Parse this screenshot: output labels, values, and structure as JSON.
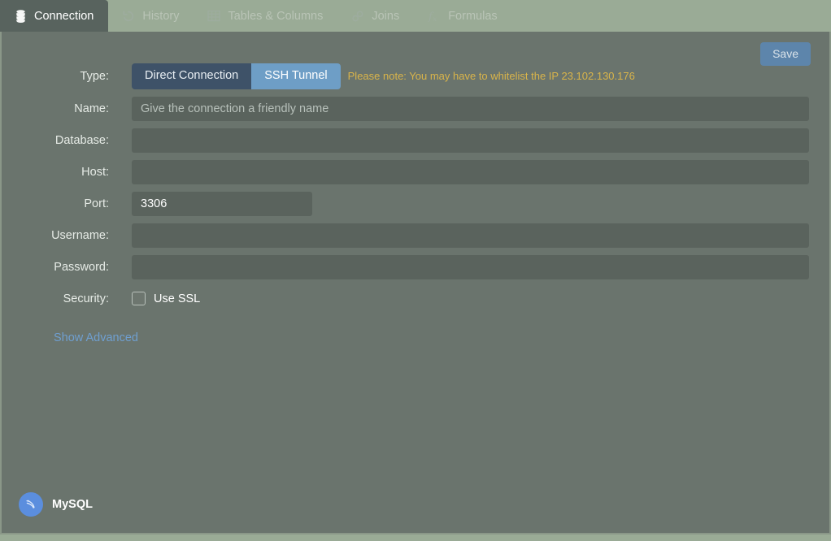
{
  "tabs": [
    {
      "label": "Connection",
      "icon": "database-icon",
      "active": true
    },
    {
      "label": "History",
      "icon": "history-icon",
      "active": false
    },
    {
      "label": "Tables & Columns",
      "icon": "table-grid-icon",
      "active": false
    },
    {
      "label": "Joins",
      "icon": "link-icon",
      "active": false
    },
    {
      "label": "Formulas",
      "icon": "function-icon",
      "active": false
    }
  ],
  "toolbar": {
    "save_label": "Save"
  },
  "form": {
    "type": {
      "label": "Type:",
      "options": [
        "Direct Connection",
        "SSH Tunnel"
      ],
      "selected": "SSH Tunnel",
      "note": "Please note: You may have to whitelist the IP 23.102.130.176"
    },
    "name": {
      "label": "Name:",
      "value": "",
      "placeholder": "Give the connection a friendly name"
    },
    "database": {
      "label": "Database:",
      "value": "",
      "placeholder": ""
    },
    "host": {
      "label": "Host:",
      "value": "",
      "placeholder": ""
    },
    "port": {
      "label": "Port:",
      "value": "3306",
      "placeholder": ""
    },
    "username": {
      "label": "Username:",
      "value": "",
      "placeholder": ""
    },
    "password": {
      "label": "Password:",
      "value": "",
      "placeholder": ""
    },
    "security": {
      "label": "Security:",
      "checkbox_label": "Use SSL",
      "checked": false
    },
    "advanced_link": "Show Advanced"
  },
  "footer": {
    "brand": "MySQL",
    "brand_icon": "mysql-dolphin-icon"
  },
  "colors": {
    "accent_blue": "#6e9ec6",
    "segment_inactive": "#3e5268",
    "save_blue": "#5d85ab",
    "note_amber": "#d9b44a",
    "link_blue": "#6f9fd0",
    "panel_bg": "#6a746d",
    "page_bg": "#9aab96",
    "field_bg": "#5a635d",
    "brand_blue": "#5b8ede"
  }
}
